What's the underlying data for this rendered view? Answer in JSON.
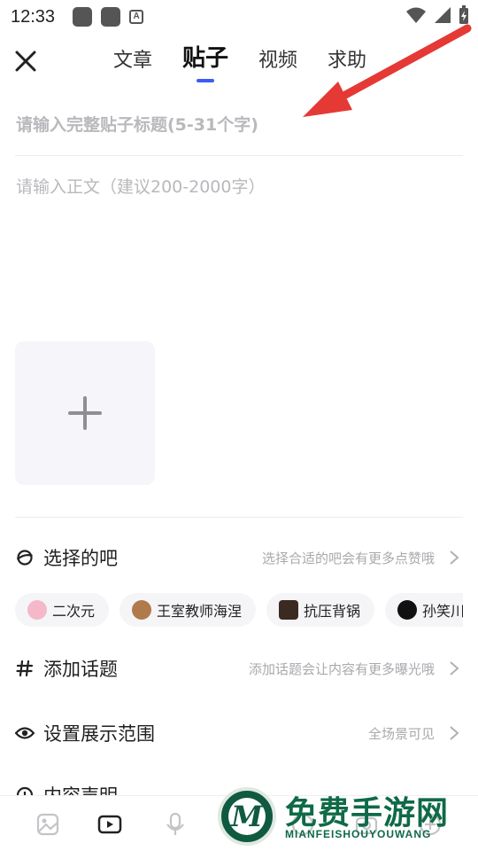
{
  "status_bar": {
    "time": "12:33"
  },
  "header": {
    "tabs": [
      {
        "label": "文章",
        "active": false
      },
      {
        "label": "贴子",
        "active": true
      },
      {
        "label": "视频",
        "active": false
      },
      {
        "label": "求助",
        "active": false
      }
    ]
  },
  "title_field": {
    "placeholder": "请输入完整贴子标题(5-31个字)",
    "value": ""
  },
  "body_field": {
    "placeholder": "请输入正文（建议200-2000字）",
    "value": ""
  },
  "rows": {
    "bar": {
      "label": "选择的吧",
      "hint": "选择合适的吧会有更多点赞哦"
    },
    "topic": {
      "label": "添加话题",
      "hint": "添加话题会让内容有更多曝光哦"
    },
    "scope": {
      "label": "设置展示范围",
      "hint": "全场景可见"
    },
    "statement": {
      "label": "内容声明"
    }
  },
  "bar_chips": [
    {
      "label": "二次元",
      "avatar_color": "#f4b8c8"
    },
    {
      "label": "王室教师海涅",
      "avatar_color": "#b07a4a"
    },
    {
      "label": "抗压背锅",
      "avatar_color": "#3a2a22"
    },
    {
      "label": "孙笑川",
      "avatar_color": "#111111"
    }
  ],
  "bottom_bar": {
    "icons": [
      "image-icon",
      "video-icon",
      "microphone-icon",
      "emoji-icon",
      "camera-icon",
      "more-icon"
    ]
  },
  "watermark": {
    "title": "免费手游网",
    "subtitle": "MIANFEISHOUYOUWANG",
    "logo_letter": "M"
  },
  "colors": {
    "accent": "#3d5cf5",
    "arrow": "#e53935",
    "watermark": "#0f6a47"
  }
}
